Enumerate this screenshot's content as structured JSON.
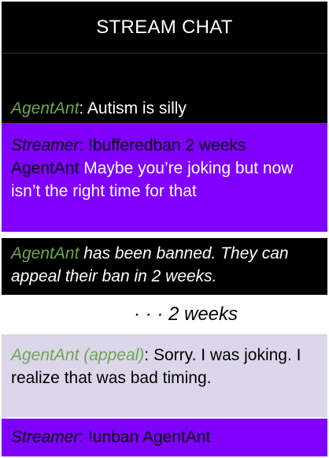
{
  "header": {
    "title": "STREAM CHAT"
  },
  "messages": [
    {
      "user": "AgentAnt",
      "sep": ": ",
      "text": "Autism is silly"
    },
    {
      "user": "Streamer",
      "sep": ": ",
      "command": "!bufferedban 2 weeks",
      "target": "AgentAnt",
      "text": " Maybe you’re joking but now isn’t the right time for that"
    },
    {
      "user": "AgentAnt",
      "text": " has been banned. They can appeal their ban in 2 weeks."
    },
    {
      "user": "AgentAnt (appeal)",
      "sep": ": ",
      "text": "Sorry. I was joking. I realize that was bad timing."
    },
    {
      "user": "Streamer",
      "sep": ": ",
      "text": "!unban AgentAnt"
    }
  ],
  "time_gap": "· · · 2 weeks",
  "colors": {
    "black": "#000000",
    "purple": "#8000ff",
    "lavender": "#dcd6ea",
    "green": "#6aa84f"
  }
}
